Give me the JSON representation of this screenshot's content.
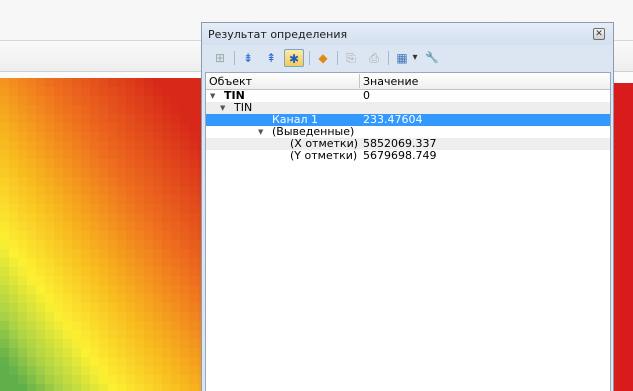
{
  "panel": {
    "title": "Результат определения",
    "close_glyph": "✕"
  },
  "toolbar": {
    "icons": [
      "expand-tree-icon",
      "expand-all-icon",
      "collapse-all-icon",
      "auto-expand-icon",
      "highlight-layer-icon",
      "copy-icon",
      "print-icon",
      "view-icon",
      "settings-wrench-icon"
    ],
    "glyphs": {
      "expand": "⊞",
      "expand_all": "⇟",
      "collapse_all": "⇞",
      "auto_expand": "✱",
      "highlight": "◆",
      "copy": "⎘",
      "print": "⎙",
      "view": "▦",
      "dropdown": "▾",
      "wrench": "🔧"
    }
  },
  "tree": {
    "columns": [
      "Объект",
      "Значение"
    ],
    "rows": [
      {
        "object": "TIN",
        "value": "0"
      },
      {
        "object": "TIN",
        "value": ""
      },
      {
        "object": "Канал 1",
        "value": "233.47604"
      },
      {
        "object": "(Выведенные)",
        "value": ""
      },
      {
        "object": "(X отметки)",
        "value": "5852069.337"
      },
      {
        "object": "(Y отметки)",
        "value": "5679698.749"
      }
    ],
    "expand_glyph": "▼"
  },
  "colors": {
    "selection": "#3399ff",
    "panel_bg": "#dce6f2",
    "raster_red": "#d81b1b"
  }
}
